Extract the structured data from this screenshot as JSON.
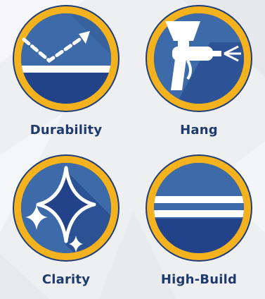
{
  "colors": {
    "ring": "#f5b21f",
    "ring_outline": "#1f3d78",
    "disc_top": "#3d6aa8",
    "disc_bottom": "#22428a",
    "white": "#ffffff",
    "label": "#1e3a6e"
  },
  "features": [
    {
      "label": "Durability",
      "icon": "durability-arrow-icon"
    },
    {
      "label": "Hang",
      "icon": "spray-gun-icon"
    },
    {
      "label": "Clarity",
      "icon": "sparkle-stars-icon"
    },
    {
      "label": "High-Build",
      "icon": "film-layers-icon"
    }
  ]
}
